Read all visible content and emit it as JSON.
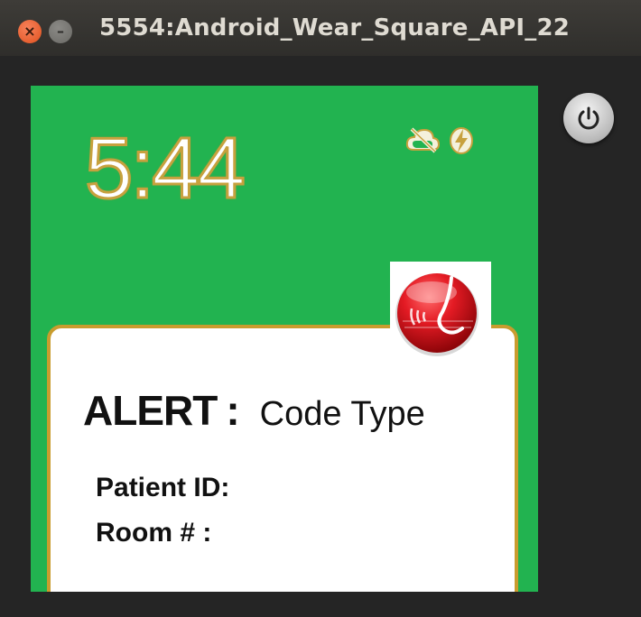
{
  "window": {
    "title": "5554:Android_Wear_Square_API_22",
    "close_glyph": "×",
    "minimize_glyph": "–"
  },
  "watch": {
    "time": "5:44",
    "status_icons": [
      "cloud-off-icon",
      "charging-bolt-icon"
    ]
  },
  "notification": {
    "alert_label": "ALERT",
    "separator": ":",
    "code_type": "Code Type",
    "patient_id_label": "Patient ID:",
    "room_label": "Room # :",
    "app_icon": "alert-app-icon"
  },
  "controls": {
    "power_icon": "power-icon"
  },
  "colors": {
    "watch_background": "#22b350",
    "card_border": "#c99c2e",
    "clock_outline": "#c7a13e",
    "app_icon_red": "#d8101c"
  }
}
